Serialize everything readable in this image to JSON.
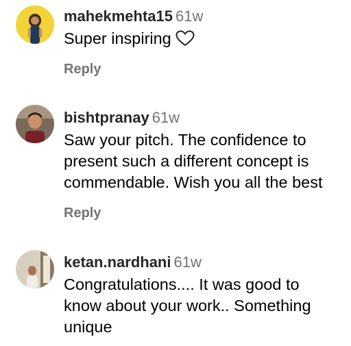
{
  "comments": [
    {
      "username": "mahekmehta15",
      "time": "61w",
      "lines": [
        "Super inspiring"
      ],
      "reply_label": "Reply"
    },
    {
      "username": "bishtpranay",
      "time": "61w",
      "lines": [
        "Saw your pitch. The confidence to",
        "present such a different concept is",
        "commendable. Wish you all the best"
      ],
      "reply_label": "Reply"
    },
    {
      "username": "ketan.nardhani",
      "time": "61w",
      "lines": [
        "Congratulations.... It was good to",
        "know about your work.. Something",
        "unique"
      ]
    }
  ],
  "icons": {
    "like": "heart-icon"
  },
  "colors": {
    "username": "#262626",
    "meta": "#737373",
    "text": "#000000",
    "background": "#ffffff"
  }
}
